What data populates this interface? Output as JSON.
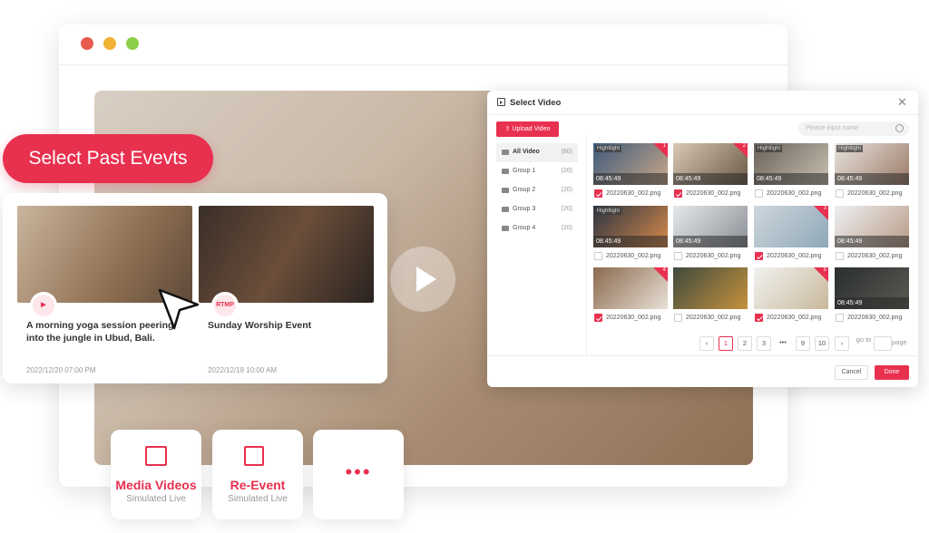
{
  "accent": "#e8304f",
  "window": {
    "traffic_lights": [
      "#e85a4f",
      "#f1b235",
      "#8bcf4a"
    ]
  },
  "pill": "Select Past Evevts",
  "events": [
    {
      "icon": "clapper-play-icon",
      "badge": "",
      "title": "A morning yoga session peering into the jungle in Ubud, Bali.",
      "date": "2022/12/20  07:00 PM"
    },
    {
      "icon": "rtmp-badge",
      "badge": "RTMP",
      "title": "Sunday Worship Event",
      "date": "2022/12/18  10:00 AM"
    }
  ],
  "tiles": [
    {
      "icon": "clapper-play-icon",
      "title": "Media Videos",
      "subtitle": "Simulated Live"
    },
    {
      "icon": "video-plus-icon",
      "title": "Re-Event",
      "subtitle": "Simulated Live"
    },
    {
      "icon": "more-dots-icon",
      "title": "",
      "subtitle": ""
    }
  ],
  "dialog": {
    "title": "Select Video",
    "upload": "Upload Video",
    "search_placeholder": "Please input name",
    "groups": [
      {
        "label": "All Video",
        "count": "(80)"
      },
      {
        "label": "Group 1",
        "count": "(20)"
      },
      {
        "label": "Group 2",
        "count": "(20)"
      },
      {
        "label": "Group 3",
        "count": "(20)"
      },
      {
        "label": "Group 4",
        "count": "(20)"
      }
    ],
    "videos": [
      {
        "name": "20220630_002.png",
        "checked": true,
        "highlight": "Hightlight",
        "time": "08:45:49",
        "badge": "1"
      },
      {
        "name": "20220630_002.png",
        "checked": true,
        "highlight": "",
        "time": "08:45:49",
        "badge": "2"
      },
      {
        "name": "20220630_002.png",
        "checked": false,
        "highlight": "Hightlight",
        "time": "08:45:49",
        "badge": ""
      },
      {
        "name": "20220630_002.png",
        "checked": false,
        "highlight": "Hightlight",
        "time": "08:45:49",
        "badge": ""
      },
      {
        "name": "20220630_002.png",
        "checked": false,
        "highlight": "Hightlight",
        "time": "08:45:49",
        "badge": ""
      },
      {
        "name": "20220630_002.png",
        "checked": false,
        "highlight": "",
        "time": "08:45:49",
        "badge": ""
      },
      {
        "name": "20220630_002.png",
        "checked": true,
        "highlight": "",
        "time": "",
        "badge": "3"
      },
      {
        "name": "20220630_002.png",
        "checked": false,
        "highlight": "",
        "time": "08:45:49",
        "badge": ""
      },
      {
        "name": "20220630_002.png",
        "checked": true,
        "highlight": "",
        "time": "",
        "badge": "4"
      },
      {
        "name": "20220630_002.png",
        "checked": false,
        "highlight": "",
        "time": "",
        "badge": ""
      },
      {
        "name": "20220630_002.png",
        "checked": true,
        "highlight": "",
        "time": "",
        "badge": "5"
      },
      {
        "name": "20220630_002.png",
        "checked": false,
        "highlight": "",
        "time": "08:45:49",
        "badge": ""
      }
    ],
    "pagination": {
      "pages": [
        "1",
        "2",
        "3",
        "9",
        "10"
      ],
      "current": "1",
      "ellipsis": "•••",
      "goto": "go to",
      "page": "page"
    },
    "cancel": "Cancel",
    "done": "Done"
  }
}
